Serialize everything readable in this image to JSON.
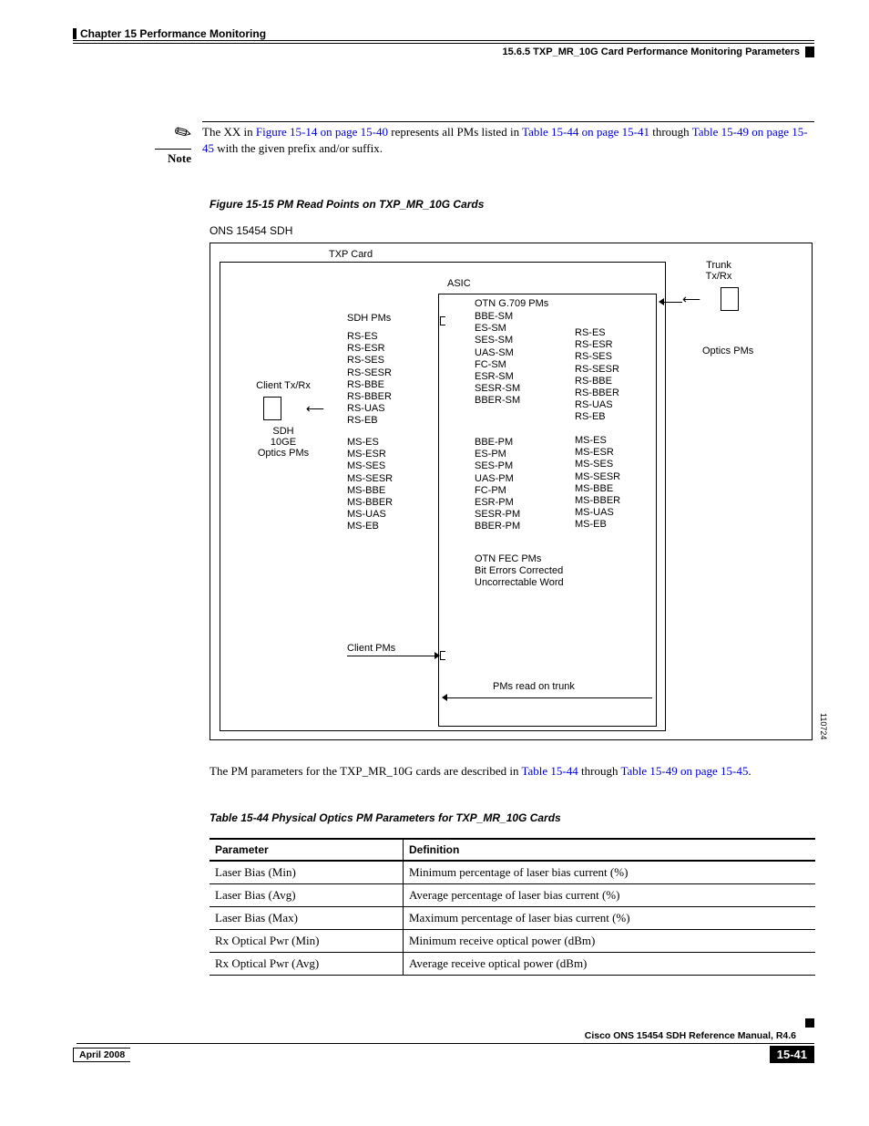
{
  "header": {
    "chapter": "Chapter 15      Performance Monitoring",
    "section": "15.6.5  TXP_MR_10G Card Performance Monitoring Parameters"
  },
  "note": {
    "label": "Note",
    "text_pre": "The XX in ",
    "link1": "Figure 15-14 on page 15-40",
    "text_mid": " represents all PMs listed in ",
    "link2": "Table 15-44 on page 15-41",
    "text_mid2": " through ",
    "link3": "Table 15-49 on page 15-45",
    "text_post": " with the given prefix and/or suffix."
  },
  "figure": {
    "caption": "Figure 15-15 PM Read Points on TXP_MR_10G Cards",
    "diagram_title": "ONS 15454 SDH",
    "txp_label": "TXP Card",
    "asic_label": "ASIC",
    "sdh_pms_label": "SDH PMs",
    "rs_list": "RS-ES\nRS-ESR\nRS-SES\nRS-SESR\nRS-BBE\nRS-BBER\nRS-UAS\nRS-EB",
    "ms_list": "MS-ES\nMS-ESR\nMS-SES\nMS-SESR\nMS-BBE\nMS-BBER\nMS-UAS\nMS-EB",
    "otn_label": "OTN G.709 PMs",
    "sm_list": "BBE-SM\nES-SM\nSES-SM\nUAS-SM\nFC-SM\nESR-SM\nSESR-SM\nBBER-SM",
    "pm_list": "BBE-PM\nES-PM\nSES-PM\nUAS-PM\nFC-PM\nESR-PM\nSESR-PM\nBBER-PM",
    "fec_list": "OTN FEC PMs\nBit Errors Corrected\nUncorrectable Word",
    "client_tx": "Client Tx/Rx",
    "client_sub": "SDH\n10GE\nOptics PMs",
    "trunk_tx": "Trunk\nTx/Rx",
    "optics_pms": "Optics PMs",
    "client_pms": "Client PMs",
    "trunk_read": "PMs read on trunk",
    "side_num": "110724"
  },
  "para": {
    "pre": "The PM parameters for the TXP_MR_10G cards are described in ",
    "link1": "Table 15-44",
    "mid": " through ",
    "link2": "Table 15-49 on page 15-45",
    "post": "."
  },
  "table": {
    "caption": "Table 15-44 Physical Optics PM Parameters for TXP_MR_10G Cards",
    "h1": "Parameter",
    "h2": "Definition",
    "rows": [
      {
        "p": "Laser Bias (Min)",
        "d": "Minimum percentage of laser bias current (%)"
      },
      {
        "p": "Laser Bias (Avg)",
        "d": "Average percentage of laser bias current (%)"
      },
      {
        "p": "Laser Bias (Max)",
        "d": "Maximum percentage of laser bias current (%)"
      },
      {
        "p": "Rx Optical Pwr (Min)",
        "d": "Minimum receive optical power (dBm)"
      },
      {
        "p": "Rx Optical Pwr (Avg)",
        "d": "Average receive optical power (dBm)"
      }
    ]
  },
  "footer": {
    "manual": "Cisco ONS 15454 SDH Reference Manual, R4.6",
    "date": "April 2008",
    "page": "15-41"
  }
}
